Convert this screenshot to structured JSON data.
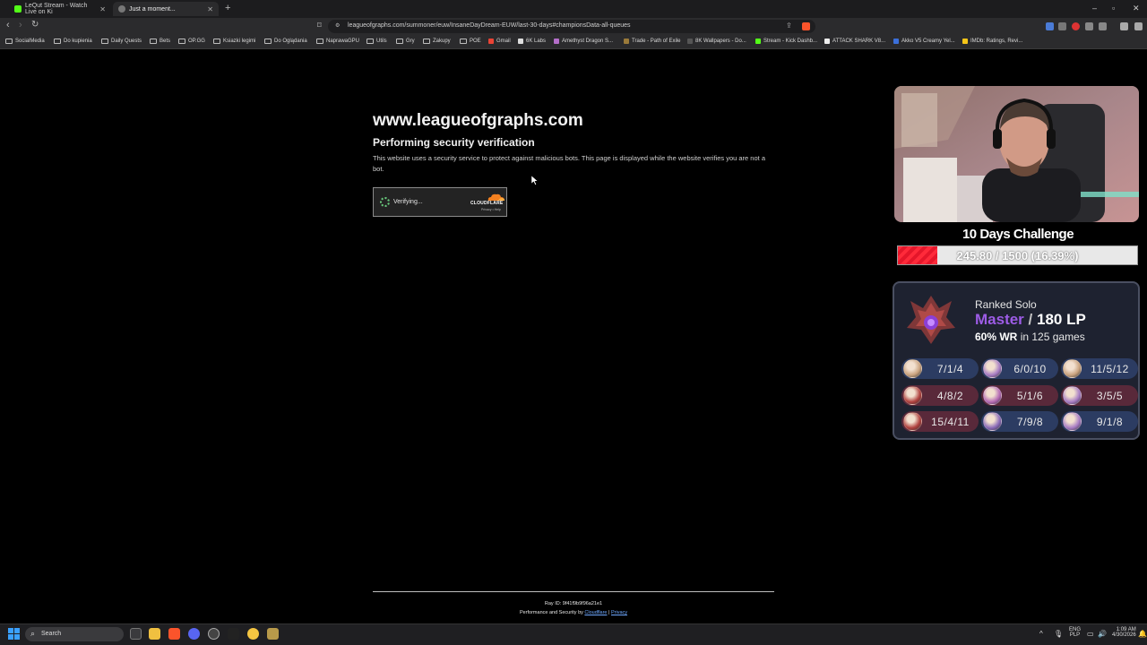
{
  "browser": {
    "tabs": [
      {
        "title": "LeQut Stream - Watch Live on Ki",
        "active": false
      },
      {
        "title": "Just a moment...",
        "active": true
      }
    ],
    "url": "leagueofgraphs.com/summoner/euw/InsaneDayDream-EUW/last-30-days#championsData-all-queues",
    "bookmarks": [
      "SocialMedia",
      "Do kupienia",
      "Daily Quests",
      "Bets",
      "OP.GG",
      "Ksiazki legimi",
      "Do Oglądania",
      "NaprawaGPU",
      "Utils",
      "Gry",
      "Zakupy",
      "POE",
      "Gmail",
      "6K Labs",
      "Amethyst Dragon S...",
      "Trade - Path of Exile",
      "8K Wallpapers - Do...",
      "Stream - Kick Dashb...",
      "ATTACK SHARK V8...",
      "Akko V5 Creamy Yel...",
      "IMDb: Ratings, Revi..."
    ]
  },
  "page": {
    "site_title": "www.leagueofgraphs.com",
    "heading": "Performing security verification",
    "description": "This website uses a security service to protect against malicious bots. This page is displayed while the website verifies you are not a bot.",
    "widget": {
      "status": "Verifying...",
      "brand": "CLOUDFLARE",
      "links": "Privacy • Help"
    },
    "footer": {
      "ray_id": "Ray ID: 9f41f9b9f96a21e1",
      "perf_prefix": "Performance and Security by",
      "perf_link": "Cloudflare",
      "separator": "|",
      "privacy": "Privacy"
    }
  },
  "overlay": {
    "challenge_title": "10 Days Challenge",
    "progress_text": "245.80 / 1500 (16.39%)",
    "progress_fraction": 0.1639,
    "ranked": {
      "label": "Ranked Solo",
      "tier": "Master",
      "separator": "/",
      "lp": "180 LP",
      "wr": "60% WR",
      "games": "in 125 games"
    },
    "games": [
      {
        "kda": "7/1/4",
        "result": "win",
        "color": "#c9a27e"
      },
      {
        "kda": "6/0/10",
        "result": "win",
        "color": "#a77cc4"
      },
      {
        "kda": "11/5/12",
        "result": "win",
        "color": "#c9a27e"
      },
      {
        "kda": "4/8/2",
        "result": "loss",
        "color": "#b0413e"
      },
      {
        "kda": "5/1/6",
        "result": "loss",
        "color": "#b56bb5"
      },
      {
        "kda": "3/5/5",
        "result": "loss",
        "color": "#a77cc4"
      },
      {
        "kda": "15/4/11",
        "result": "loss",
        "color": "#b0413e"
      },
      {
        "kda": "7/9/8",
        "result": "win",
        "color": "#8a6ab8"
      },
      {
        "kda": "9/1/8",
        "result": "win",
        "color": "#a77cc4"
      }
    ]
  },
  "taskbar": {
    "search": "Search",
    "lang": "ENG",
    "lang_sub": "PLP",
    "time": "1:09 AM",
    "date": "4/30/2026"
  }
}
